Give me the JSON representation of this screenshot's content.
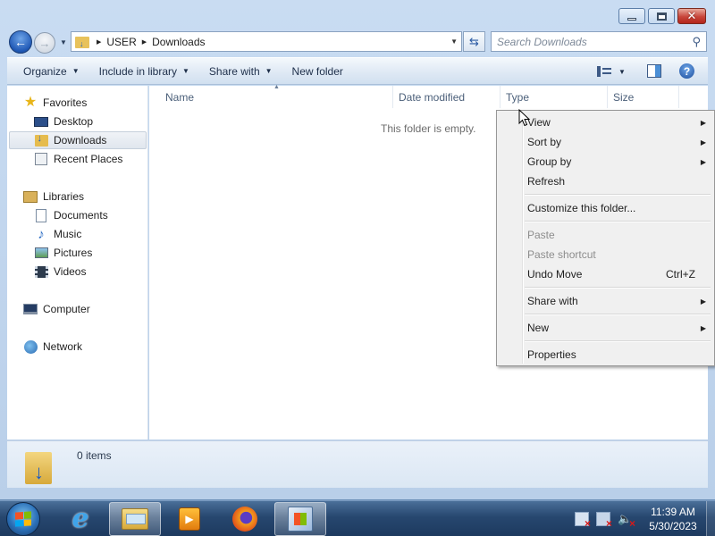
{
  "window": {
    "minimize_glyph": "minimize-icon",
    "maximize_glyph": "maximize-icon",
    "close_glyph": "✕"
  },
  "address": {
    "crumbs": [
      "USER",
      "Downloads"
    ]
  },
  "search": {
    "placeholder": "Search Downloads"
  },
  "toolbar": {
    "organize": "Organize",
    "include_in_library": "Include in library",
    "share_with": "Share with",
    "new_folder": "New folder",
    "help": "?"
  },
  "sidebar": {
    "favorites": {
      "label": "Favorites",
      "items": [
        "Desktop",
        "Downloads",
        "Recent Places"
      ],
      "selected": "Downloads"
    },
    "libraries": {
      "label": "Libraries",
      "items": [
        "Documents",
        "Music",
        "Pictures",
        "Videos"
      ]
    },
    "computer": "Computer",
    "network": "Network"
  },
  "columns": [
    "Name",
    "Date modified",
    "Type",
    "Size"
  ],
  "content": {
    "empty_message": "This folder is empty."
  },
  "details": {
    "items_count": "0 items"
  },
  "context_menu": {
    "items": [
      {
        "label": "View",
        "submenu": true
      },
      {
        "label": "Sort by",
        "submenu": true
      },
      {
        "label": "Group by",
        "submenu": true
      },
      {
        "label": "Refresh"
      },
      {
        "label": "Customize this folder..."
      },
      {
        "label": "Paste",
        "disabled": true
      },
      {
        "label": "Paste shortcut",
        "disabled": true
      },
      {
        "label": "Undo Move",
        "shortcut": "Ctrl+Z"
      },
      {
        "label": "Share with",
        "submenu": true
      },
      {
        "label": "New",
        "submenu": true
      },
      {
        "label": "Properties"
      }
    ]
  },
  "taskbar": {
    "apps": [
      "internet-explorer",
      "windows-explorer",
      "windows-media-player",
      "firefox",
      "windows-update"
    ],
    "active_apps": [
      "windows-explorer",
      "windows-update"
    ],
    "clock_time": "11:39 AM",
    "clock_date": "5/30/2023"
  }
}
